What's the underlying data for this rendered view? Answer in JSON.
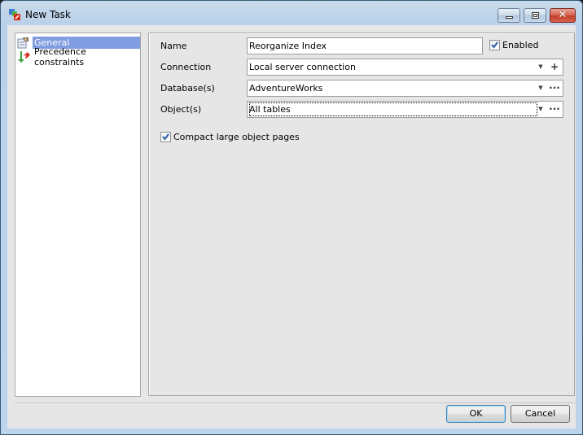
{
  "window": {
    "title": "New Task",
    "icon": "task-app-icon",
    "controls": {
      "minimize": "minimize-icon",
      "maximize": "maximize-icon",
      "close": "close-icon"
    }
  },
  "nav": {
    "items": [
      {
        "label": "General",
        "icon": "general-page-icon",
        "selected": true
      },
      {
        "label": "Precedence constraints",
        "icon": "precedence-constraints-icon",
        "selected": false
      }
    ]
  },
  "form": {
    "name": {
      "label": "Name",
      "value": "Reorganize Index"
    },
    "enabled": {
      "label": "Enabled",
      "checked": true
    },
    "connection": {
      "label": "Connection",
      "value": "Local server connection",
      "extra_button": "+"
    },
    "databases": {
      "label": "Database(s)",
      "value": "AdventureWorks",
      "extra_button": "···"
    },
    "objects": {
      "label": "Object(s)",
      "value": "All tables",
      "extra_button": "···"
    },
    "compact": {
      "label": "Compact large object pages",
      "checked": true
    },
    "dropdown_glyph": "▼"
  },
  "buttons": {
    "ok": "OK",
    "cancel": "Cancel"
  }
}
